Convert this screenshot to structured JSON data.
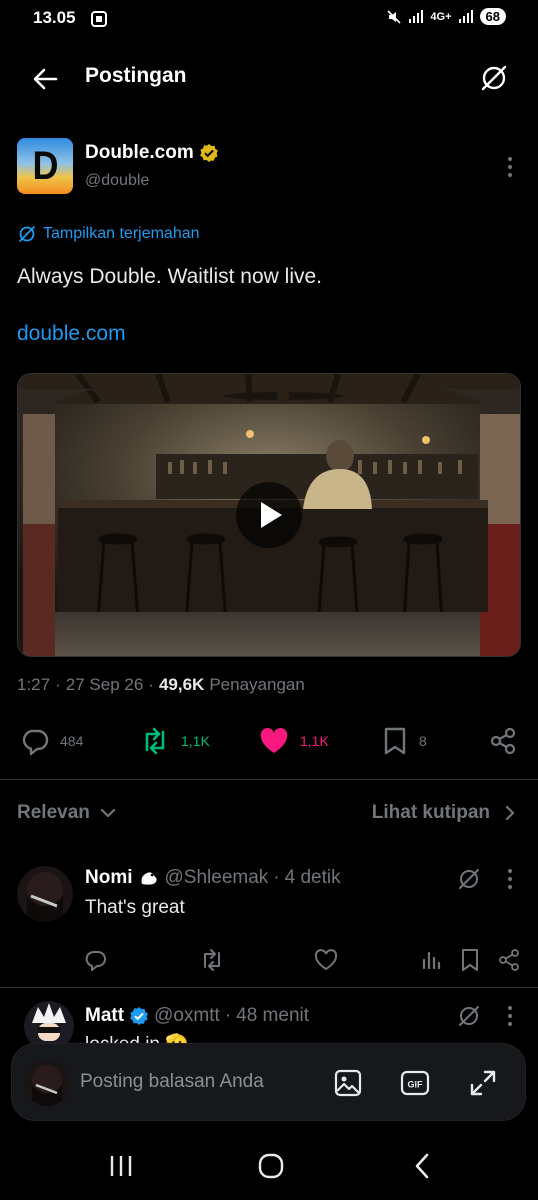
{
  "status_bar": {
    "time": "13.05",
    "network": "4G+",
    "battery": "68"
  },
  "header": {
    "title": "Postingan"
  },
  "post": {
    "author_name": "Double.com",
    "author_handle": "@double",
    "avatar_letter": "D",
    "translate_label": "Tampilkan terjemahan",
    "text": "Always Double. Waitlist now live.",
    "link": "double.com",
    "time": "1:27",
    "date": "27 Sep 26",
    "views": "49,6K",
    "views_label": "Penayangan",
    "stats": {
      "replies": "484",
      "reposts": "1,1K",
      "likes": "1,1K",
      "bookmarks": "8"
    }
  },
  "sort": {
    "relevan_label": "Relevan",
    "quotes_label": "Lihat kutipan"
  },
  "replies": [
    {
      "name": "Nomi",
      "handle": "@Shleemak",
      "time": "4 detik",
      "text": "That's great"
    },
    {
      "name": "Matt",
      "handle": "@oxmtt",
      "time": "48 menit",
      "text": "locked in 🫡"
    }
  ],
  "composer": {
    "placeholder": "Posting balasan Anda"
  },
  "colors": {
    "accent": "#1d9bf0",
    "repost": "#00ba7c",
    "like": "#f91880",
    "muted": "#71767b",
    "verified": "#e2b719"
  },
  "icons": [
    "back-arrow-icon",
    "translate-icon",
    "more-dots-icon",
    "verified-badge-icon",
    "play-icon",
    "reply-icon",
    "repost-icon",
    "heart-icon",
    "bookmark-icon",
    "share-icon",
    "chevron-down-icon",
    "chevron-right-icon",
    "views-icon",
    "image-icon",
    "gif-icon",
    "expand-icon"
  ]
}
